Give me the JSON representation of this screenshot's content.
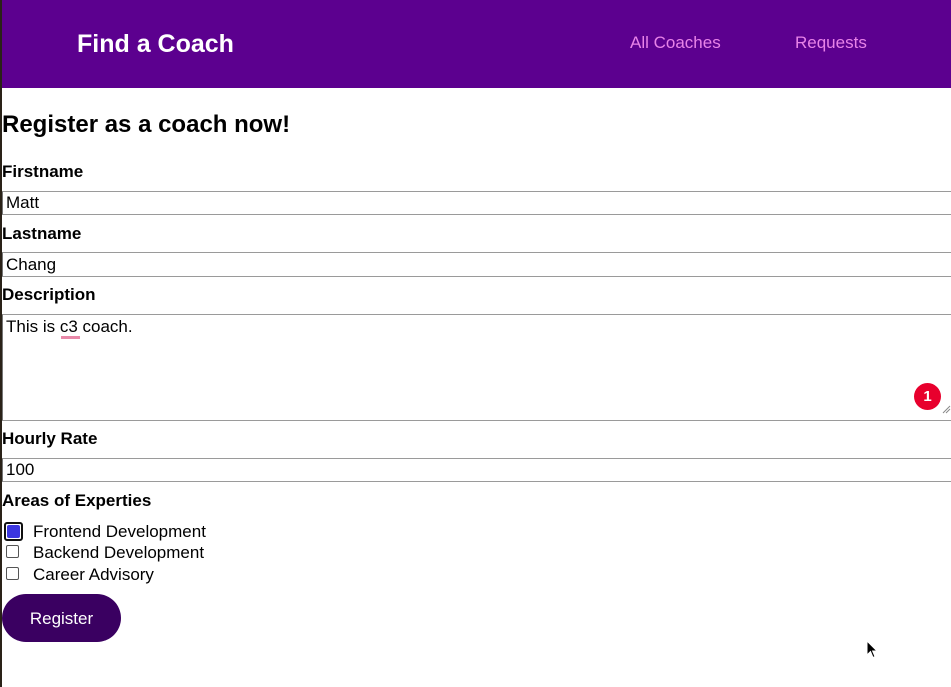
{
  "header": {
    "brand": "Find a Coach",
    "nav": [
      {
        "label": "All Coaches"
      },
      {
        "label": "Requests"
      }
    ],
    "colors": {
      "bar": "#5c008f",
      "link": "#e883e8"
    }
  },
  "form": {
    "title": "Register as a coach now!",
    "firstname": {
      "label": "Firstname",
      "value": "Matt"
    },
    "lastname": {
      "label": "Lastname",
      "value": "Chang"
    },
    "description": {
      "label": "Description",
      "value": "This is c3 coach."
    },
    "rate": {
      "label": "Hourly Rate",
      "value": "100"
    },
    "areas": {
      "label": "Areas of Experties",
      "options": [
        {
          "label": "Frontend Development",
          "checked": true
        },
        {
          "label": "Backend Development",
          "checked": false
        },
        {
          "label": "Career Advisory",
          "checked": false
        }
      ]
    },
    "submit_label": "Register",
    "colors": {
      "button": "#3a0061",
      "checkbox_accent": "#3b36e0"
    }
  },
  "notification": {
    "count": "1",
    "color": "#e8002d"
  },
  "icons": {
    "cursor": "mouse-pointer-icon",
    "grip": "resize-grip-icon"
  }
}
